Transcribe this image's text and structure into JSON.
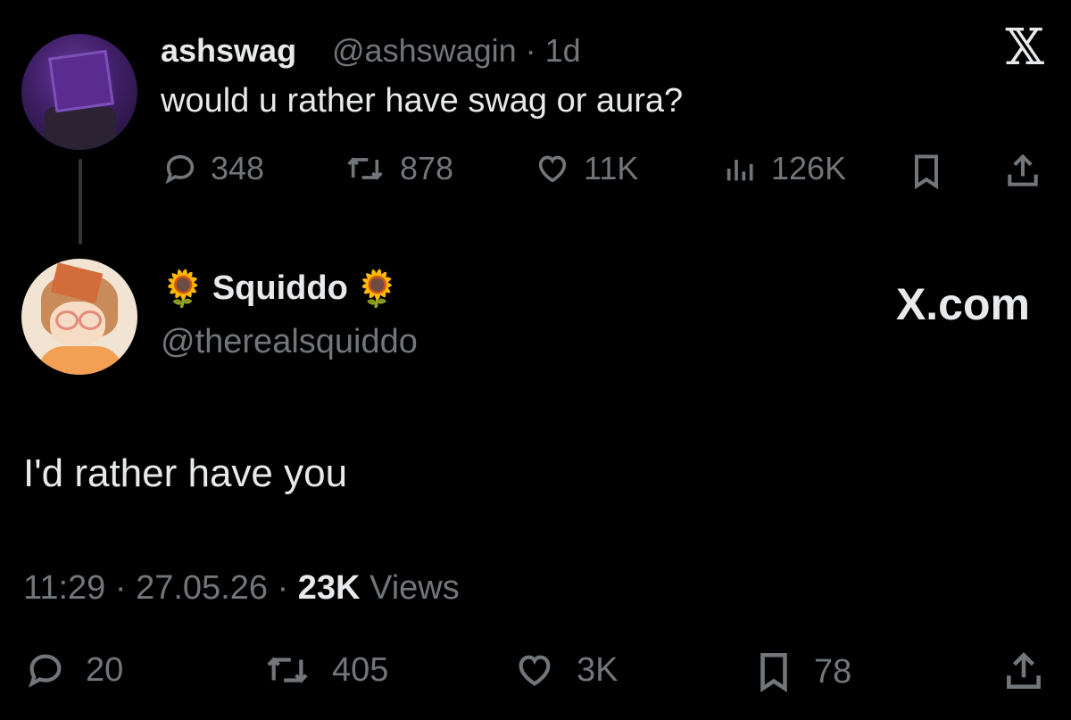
{
  "parent_tweet": {
    "display_name": "ashswag",
    "handle": "@ashswagin",
    "time": "· 1d",
    "text": "would u rather have swag or aura?",
    "stats": {
      "replies": "348",
      "retweets": "878",
      "likes": "11K",
      "views": "126K"
    }
  },
  "reply_tweet": {
    "name_prefix_emoji": "🌻",
    "display_name": "Squiddo",
    "name_suffix_emoji": "🌻",
    "handle": "@therealsquiddo",
    "text": "I'd rather have you",
    "time": "11:29",
    "date": "27.05.26",
    "views_count": "23K",
    "views_label": "Views",
    "separator": "·",
    "stats": {
      "replies": "20",
      "retweets": "405",
      "likes": "3K",
      "bookmarks": "78"
    }
  },
  "brand": {
    "logo_glyph": "𝕏",
    "watermark": "X.com"
  },
  "colors": {
    "background": "#000000",
    "text": "#e7e9ea",
    "muted": "#71767b",
    "thread_line": "#333639"
  },
  "icons": [
    "reply-icon",
    "retweet-icon",
    "like-icon",
    "views-icon",
    "bookmark-icon",
    "share-icon",
    "x-logo-icon"
  ]
}
